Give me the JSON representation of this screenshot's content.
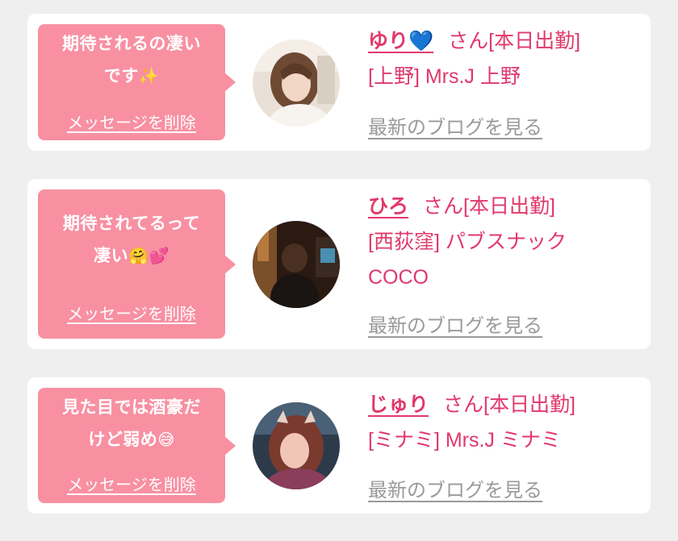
{
  "messages": [
    {
      "message_text": "期待されるの凄い\nです",
      "message_emoji": "✨",
      "delete_label": "メッセージを削除",
      "name": "ゆり",
      "name_emoji": "💙",
      "honorific_status": "さん[本日出勤]",
      "shop": "[上野] Mrs.J 上野",
      "blog_link": "最新のブログを見る",
      "avatar_icon": "avatar-yuri"
    },
    {
      "message_text": "期待されてるって\n凄い",
      "message_emoji": "🤗💕",
      "delete_label": "メッセージを削除",
      "name": "ひろ",
      "name_emoji": "",
      "honorific_status": "さん[本日出勤]",
      "shop": "[西荻窪] パブスナック\nCOCO",
      "blog_link": "最新のブログを見る",
      "avatar_icon": "avatar-hiro"
    },
    {
      "message_text": "見た目では酒豪だ\nけど弱め",
      "message_emoji": "😅",
      "delete_label": "メッセージを削除",
      "name": "じゅり",
      "name_emoji": "",
      "honorific_status": "さん[本日出勤]",
      "shop": "[ミナミ] Mrs.J ミナミ",
      "blog_link": "最新のブログを見る",
      "avatar_icon": "avatar-juri"
    }
  ],
  "colors": {
    "page_background": "#efefef",
    "card_background": "#ffffff",
    "bubble": "#f890a2",
    "accent_text": "#e1386c",
    "muted_link": "#9a9a9a"
  }
}
